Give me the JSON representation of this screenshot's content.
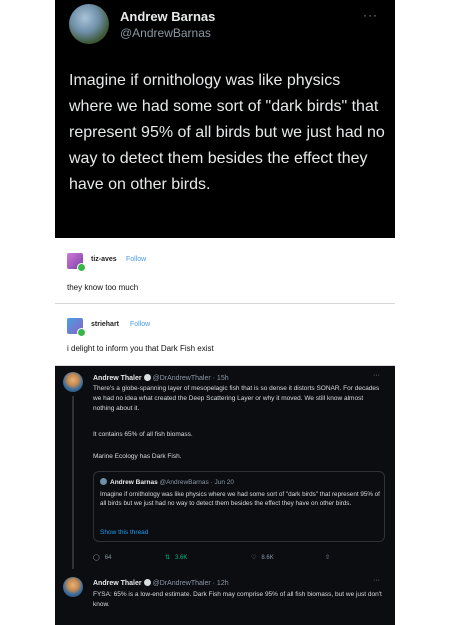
{
  "tweet1": {
    "name": "Andrew Barnas",
    "handle": "@AndrewBarnas",
    "more": "···",
    "text": "Imagine if ornithology was like physics where we had some sort of \"dark birds\" that represent 95% of all birds but we just had no way to detect them besides the effect they have on other birds."
  },
  "post1": {
    "user": "tiz-aves",
    "follow": "Follow",
    "body": "they know too much"
  },
  "post2": {
    "user": "striehart",
    "follow": "Follow",
    "body": "i delight to inform you that Dark Fish exist"
  },
  "tweet2": {
    "name": "Andrew Thaler",
    "handle": "@DrAndrewThaler",
    "time": "· 15h",
    "more": "···",
    "para1": "There's a globe-spanning layer of mesopelagic fish that is so dense it distorts SONAR. For decades we had no idea what created the Deep Scattering Layer or why it moved. We still know almost nothing about it.",
    "para2": "It contains 65% of all fish biomass.",
    "para3": "Marine Ecology has Dark Fish.",
    "quote": {
      "name": "Andrew Barnas",
      "handle": "@AndrewBarnas · Jun 20",
      "text": "Imagine if ornithology was like physics where we had some sort of \"dark birds\" that represent 95% of all birds but we just had no way to detect them besides the effect they have on other birds.",
      "show_thread": "Show this thread"
    },
    "actions": {
      "replies": "64",
      "retweets": "3.6K",
      "likes": "8.6K"
    }
  },
  "tweet3": {
    "name": "Andrew Thaler",
    "handle": "@DrAndrewThaler",
    "time": "· 12h",
    "more": "···",
    "text": "FYSA: 65% is a low-end estimate. Dark Fish may comprise 95% of all fish biomass, but we just don't know."
  }
}
